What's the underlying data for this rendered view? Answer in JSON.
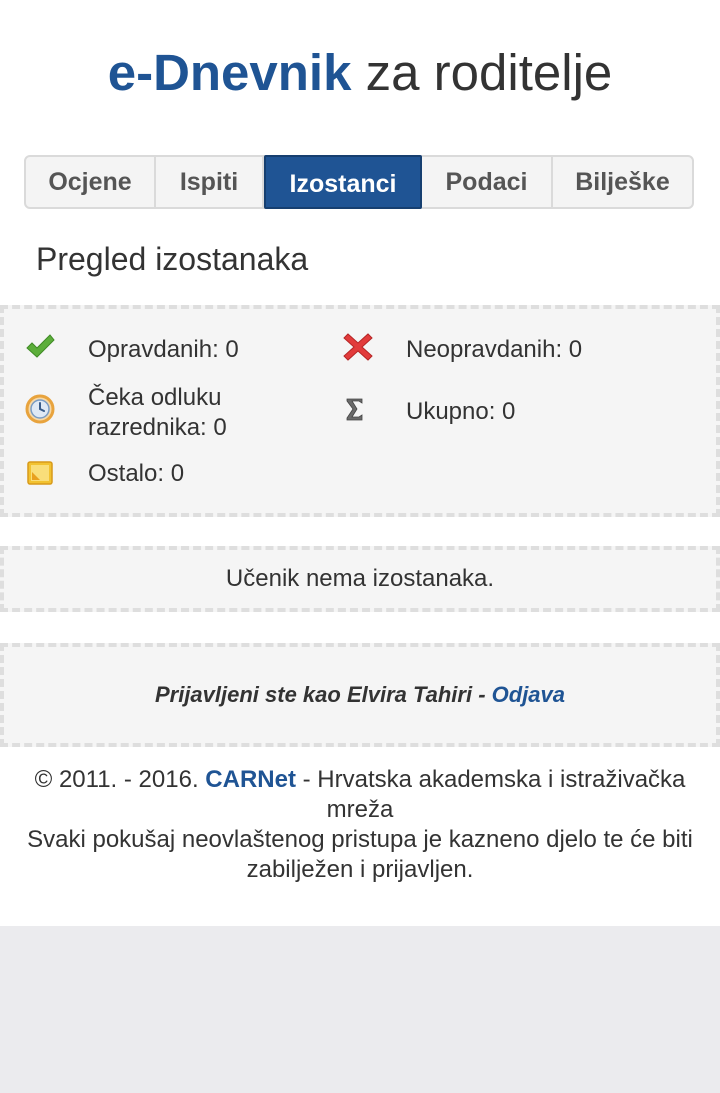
{
  "header": {
    "brand": "e-Dnevnik",
    "subtitle": " za roditelje"
  },
  "tabs": [
    {
      "label": "Ocjene",
      "active": false
    },
    {
      "label": "Ispiti",
      "active": false
    },
    {
      "label": "Izostanci",
      "active": true
    },
    {
      "label": "Podaci",
      "active": false
    },
    {
      "label": "Bilješke",
      "active": false
    }
  ],
  "section_title": "Pregled izostanaka",
  "summary": {
    "justified": "Opravdanih: 0",
    "unjustified": "Neopravdanih: 0",
    "pending_line1": "Čeka odluku",
    "pending_line2": "razrednika: 0",
    "total": "Ukupno: 0",
    "other": "Ostalo: 0"
  },
  "no_absences": "Učenik nema izostanaka.",
  "login": {
    "prefix": "Prijavljeni ste kao Elvira Tahiri - ",
    "logout_label": "Odjava"
  },
  "footer": {
    "copyright": "© 2011. - 2016. ",
    "carnet": "CARNet",
    "org": " - Hrvatska akademska i istraživačka mreža",
    "warning": "Svaki pokušaj neovlaštenog pristupa je kazneno djelo te će biti zabilježen i prijavljen."
  },
  "colors": {
    "brand_blue": "#1f5494",
    "check_green": "#5cae3a",
    "cross_red": "#e23b3b",
    "clock_orange": "#e8a33d",
    "other_yellow": "#f2c230"
  },
  "icons": [
    "check-icon",
    "cross-icon",
    "clock-icon",
    "sigma-icon",
    "other-icon"
  ]
}
